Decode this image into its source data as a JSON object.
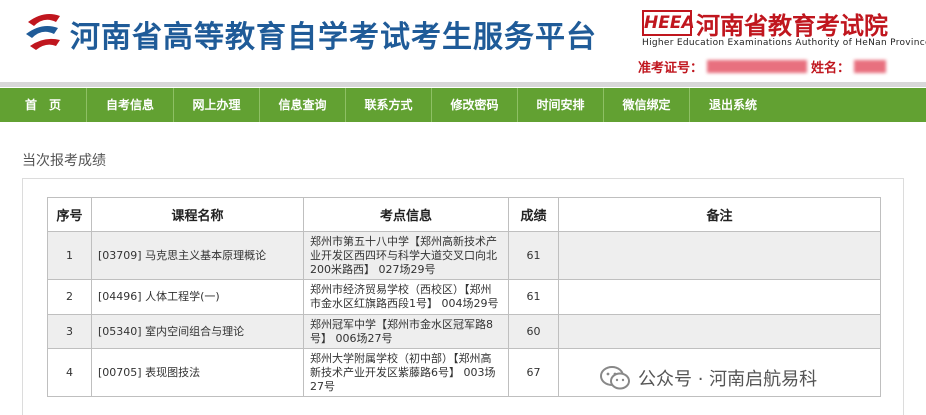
{
  "header": {
    "title": "河南省高等教育自学考试考生服务平台",
    "authority_badge": "HEEA",
    "authority_name": "河南省教育考试院",
    "authority_en": "Higher Education Examinations Authority of HeNan Province",
    "candidate_no_label": "准考证号：",
    "name_label": "姓名："
  },
  "nav": [
    {
      "label": "首　页"
    },
    {
      "label": "自考信息"
    },
    {
      "label": "网上办理"
    },
    {
      "label": "信息查询"
    },
    {
      "label": "联系方式"
    },
    {
      "label": "修改密码"
    },
    {
      "label": "时间安排"
    },
    {
      "label": "微信绑定"
    },
    {
      "label": "退出系统"
    }
  ],
  "section_title": "当次报考成绩",
  "table": {
    "headers": [
      "序号",
      "课程名称",
      "考点信息",
      "成绩",
      "备注"
    ],
    "rows": [
      {
        "no": "1",
        "course": "[03709] 马克思主义基本原理概论",
        "site": "郑州市第五十八中学【郑州高新技术产业开发区西四环与科学大道交叉口向北200米路西】 027场29号",
        "score": "61",
        "remark": ""
      },
      {
        "no": "2",
        "course": "[04496] 人体工程学(一)",
        "site": "郑州市经济贸易学校（西校区）【郑州市金水区红旗路西段1号】 004场29号",
        "score": "61",
        "remark": ""
      },
      {
        "no": "3",
        "course": "[05340] 室内空间组合与理论",
        "site": "郑州冠军中学【郑州市金水区冠军路8号】 006场27号",
        "score": "60",
        "remark": ""
      },
      {
        "no": "4",
        "course": "[00705] 表现图技法",
        "site": "郑州大学附属学校（初中部）【郑州高新技术产业开发区紫藤路6号】 003场27号",
        "score": "67",
        "remark": ""
      }
    ]
  },
  "watermark": "公众号 · 河南启航易科",
  "colors": {
    "nav_bg": "#62a132",
    "title_blue": "#1f5b98",
    "authority_red": "#c0161e"
  }
}
